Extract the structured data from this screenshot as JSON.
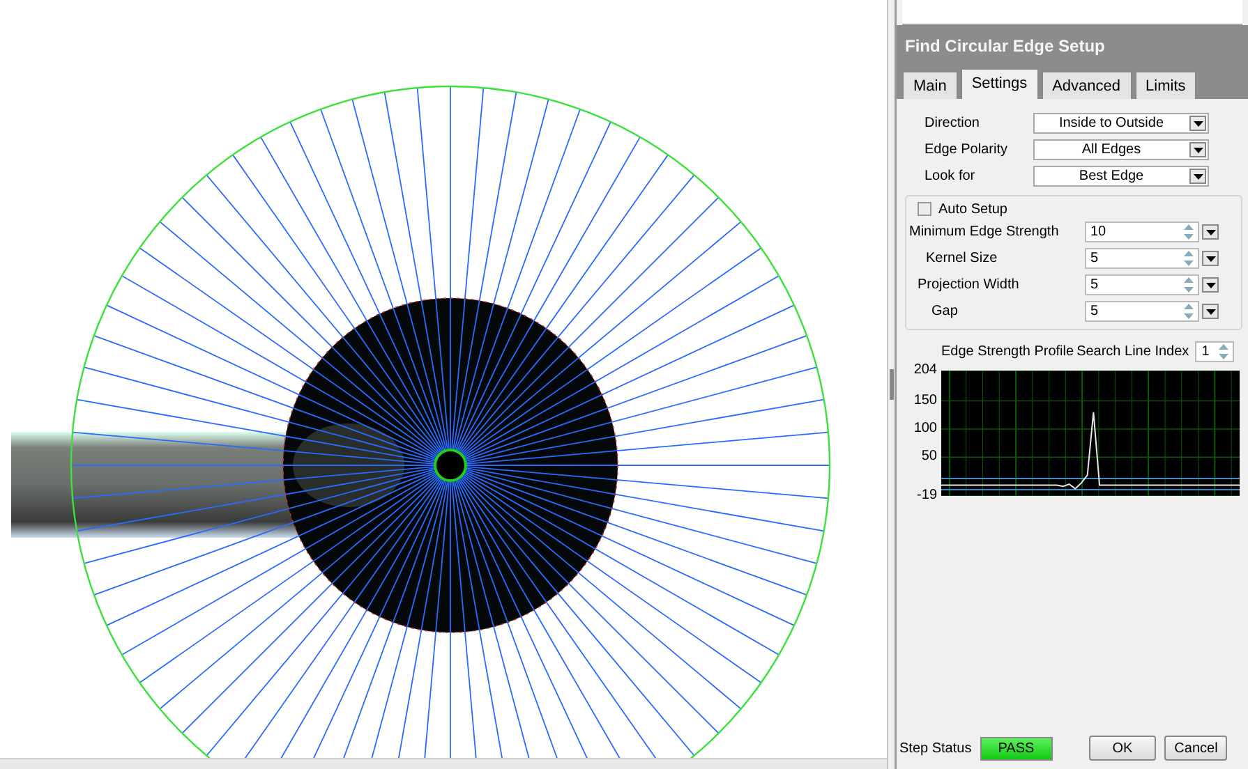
{
  "dialog": {
    "title": "Find Circular Edge Setup"
  },
  "tabs": [
    {
      "label": "Main",
      "selected": false
    },
    {
      "label": "Settings",
      "selected": true
    },
    {
      "label": "Advanced",
      "selected": false
    },
    {
      "label": "Limits",
      "selected": false
    }
  ],
  "selects": [
    {
      "label": "Direction",
      "value": "Inside to Outside"
    },
    {
      "label": "Edge Polarity",
      "value": "All Edges"
    },
    {
      "label": "Look for",
      "value": "Best Edge"
    }
  ],
  "auto_setup": {
    "label": "Auto Setup",
    "checked": false
  },
  "numeric_fields": [
    {
      "label": "Minimum Edge Strength",
      "value": "10"
    },
    {
      "label": "Kernel Size",
      "value": "5"
    },
    {
      "label": "Projection Width",
      "value": "5"
    },
    {
      "label": "Gap",
      "value": "5"
    }
  ],
  "profile": {
    "title": "Edge Strength Profile",
    "index_label": "Search Line Index",
    "index_value": "1",
    "chart_data": {
      "type": "line",
      "ylim": [
        -19,
        204
      ],
      "grid": true,
      "ref_lines": [
        {
          "axis": "y",
          "value": 12,
          "color": "#3a8ad0"
        },
        {
          "axis": "y",
          "value": -8,
          "color": "#3a8ad0"
        }
      ],
      "yticks": [
        {
          "value": 204,
          "label": "204"
        },
        {
          "value": 150,
          "label": "150"
        },
        {
          "value": 100,
          "label": "100"
        },
        {
          "value": 50,
          "label": "50"
        },
        {
          "value": -19,
          "label": "-19"
        }
      ],
      "series": [
        {
          "color": "#e8e8e8",
          "values": [
            0,
            0,
            0,
            0,
            0,
            0,
            0,
            0,
            0,
            0,
            0,
            0,
            0,
            0,
            0,
            0,
            0,
            0,
            0,
            0,
            -2,
            2,
            -6,
            4,
            18,
            130,
            0,
            0,
            0,
            0,
            0,
            0,
            0,
            0,
            0,
            0,
            0,
            0,
            0,
            0,
            0,
            0,
            0,
            0,
            0,
            0,
            0,
            0,
            0,
            0
          ]
        }
      ]
    }
  },
  "step_status": {
    "label": "Step Status",
    "value": "PASS"
  },
  "buttons": [
    "OK",
    "Cancel"
  ]
}
